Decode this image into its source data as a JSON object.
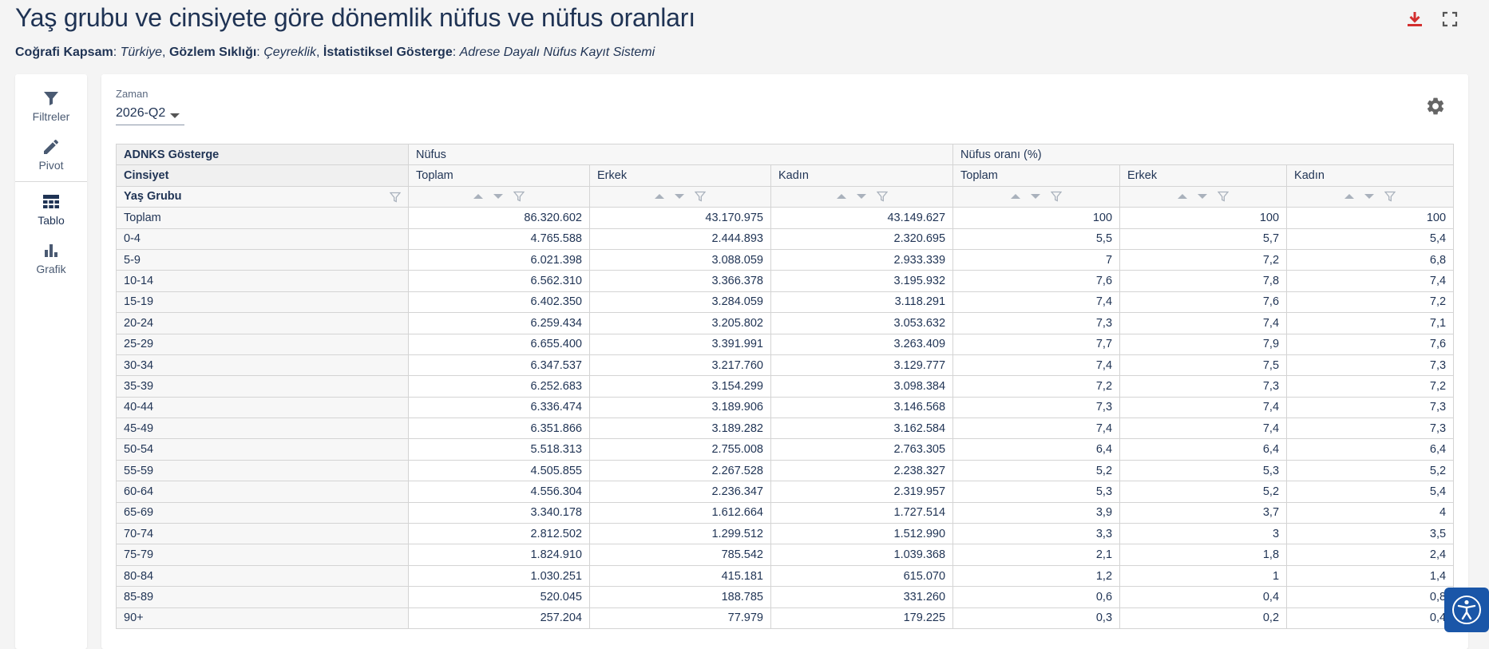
{
  "page": {
    "title": "Yaş grubu ve cinsiyete göre dönemlik nüfus ve nüfus oranları",
    "meta": {
      "kapsam_label": "Coğrafi Kapsam",
      "kapsam_value": "Türkiye",
      "siklik_label": "Gözlem Sıklığı",
      "siklik_value": "Çeyreklik",
      "gosterge_label": "İstatistiksel Gösterge",
      "gosterge_value": "Adrese Dayalı Nüfus Kayıt Sistemi"
    },
    "icons": {
      "download": "download-icon",
      "fullscreen": "fullscreen-icon",
      "settings": "gear-icon",
      "accessibility": "accessibility-icon"
    },
    "colors": {
      "download": "#d32f2f",
      "text": "#1f3354",
      "a11y": "#1a56a8"
    }
  },
  "sidebar": {
    "items": [
      {
        "label": "Filtreler",
        "icon": "filter-icon"
      },
      {
        "label": "Pivot",
        "icon": "pencil-icon"
      },
      {
        "label": "Tablo",
        "icon": "table-icon",
        "active": true
      },
      {
        "label": "Grafik",
        "icon": "bar-chart-icon"
      }
    ]
  },
  "filter": {
    "zaman_label": "Zaman",
    "zaman_value": "2026-Q2"
  },
  "table": {
    "hdr_gosterge": "ADNKS Gösterge",
    "hdr_cinsiyet": "Cinsiyet",
    "hdr_yas": "Yaş Grubu",
    "group_nufus": "Nüfus",
    "group_oran": "Nüfus oranı (%)",
    "cols": [
      "Toplam",
      "Erkek",
      "Kadın",
      "Toplam",
      "Erkek",
      "Kadın"
    ],
    "rows": [
      [
        "Toplam",
        "86.320.602",
        "43.170.975",
        "43.149.627",
        "100",
        "100",
        "100"
      ],
      [
        "0-4",
        "4.765.588",
        "2.444.893",
        "2.320.695",
        "5,5",
        "5,7",
        "5,4"
      ],
      [
        "5-9",
        "6.021.398",
        "3.088.059",
        "2.933.339",
        "7",
        "7,2",
        "6,8"
      ],
      [
        "10-14",
        "6.562.310",
        "3.366.378",
        "3.195.932",
        "7,6",
        "7,8",
        "7,4"
      ],
      [
        "15-19",
        "6.402.350",
        "3.284.059",
        "3.118.291",
        "7,4",
        "7,6",
        "7,2"
      ],
      [
        "20-24",
        "6.259.434",
        "3.205.802",
        "3.053.632",
        "7,3",
        "7,4",
        "7,1"
      ],
      [
        "25-29",
        "6.655.400",
        "3.391.991",
        "3.263.409",
        "7,7",
        "7,9",
        "7,6"
      ],
      [
        "30-34",
        "6.347.537",
        "3.217.760",
        "3.129.777",
        "7,4",
        "7,5",
        "7,3"
      ],
      [
        "35-39",
        "6.252.683",
        "3.154.299",
        "3.098.384",
        "7,2",
        "7,3",
        "7,2"
      ],
      [
        "40-44",
        "6.336.474",
        "3.189.906",
        "3.146.568",
        "7,3",
        "7,4",
        "7,3"
      ],
      [
        "45-49",
        "6.351.866",
        "3.189.282",
        "3.162.584",
        "7,4",
        "7,4",
        "7,3"
      ],
      [
        "50-54",
        "5.518.313",
        "2.755.008",
        "2.763.305",
        "6,4",
        "6,4",
        "6,4"
      ],
      [
        "55-59",
        "4.505.855",
        "2.267.528",
        "2.238.327",
        "5,2",
        "5,3",
        "5,2"
      ],
      [
        "60-64",
        "4.556.304",
        "2.236.347",
        "2.319.957",
        "5,3",
        "5,2",
        "5,4"
      ],
      [
        "65-69",
        "3.340.178",
        "1.612.664",
        "1.727.514",
        "3,9",
        "3,7",
        "4"
      ],
      [
        "70-74",
        "2.812.502",
        "1.299.512",
        "1.512.990",
        "3,3",
        "3",
        "3,5"
      ],
      [
        "75-79",
        "1.824.910",
        "785.542",
        "1.039.368",
        "2,1",
        "1,8",
        "2,4"
      ],
      [
        "80-84",
        "1.030.251",
        "415.181",
        "615.070",
        "1,2",
        "1",
        "1,4"
      ],
      [
        "85-89",
        "520.045",
        "188.785",
        "331.260",
        "0,6",
        "0,4",
        "0,8"
      ],
      [
        "90+",
        "257.204",
        "77.979",
        "179.225",
        "0,3",
        "0,2",
        "0,4"
      ]
    ]
  }
}
